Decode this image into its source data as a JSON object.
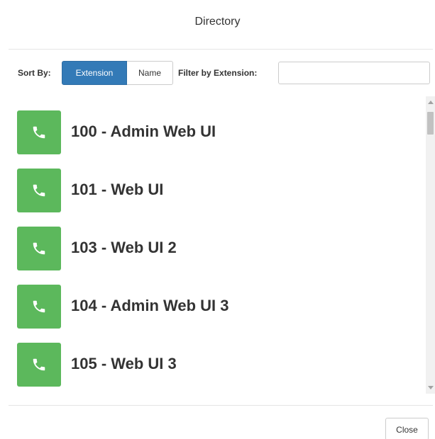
{
  "dialog": {
    "title": "Directory",
    "close_label": "Close"
  },
  "toolbar": {
    "sort_label": "Sort By:",
    "sort_options": [
      {
        "label": "Extension",
        "active": true
      },
      {
        "label": "Name",
        "active": false
      }
    ],
    "filter_label": "Filter by Extension:",
    "filter_value": "",
    "filter_placeholder": ""
  },
  "directory": {
    "entries": [
      {
        "label": "100 - Admin Web UI",
        "icon": "phone-icon"
      },
      {
        "label": "101 - Web UI",
        "icon": "phone-icon"
      },
      {
        "label": "103 - Web UI 2",
        "icon": "phone-icon"
      },
      {
        "label": "104 - Admin Web UI 3",
        "icon": "phone-icon"
      },
      {
        "label": "105 - Web UI 3",
        "icon": "phone-icon"
      }
    ]
  },
  "colors": {
    "accent": "#337ab7",
    "call_button": "#5cb85c"
  }
}
